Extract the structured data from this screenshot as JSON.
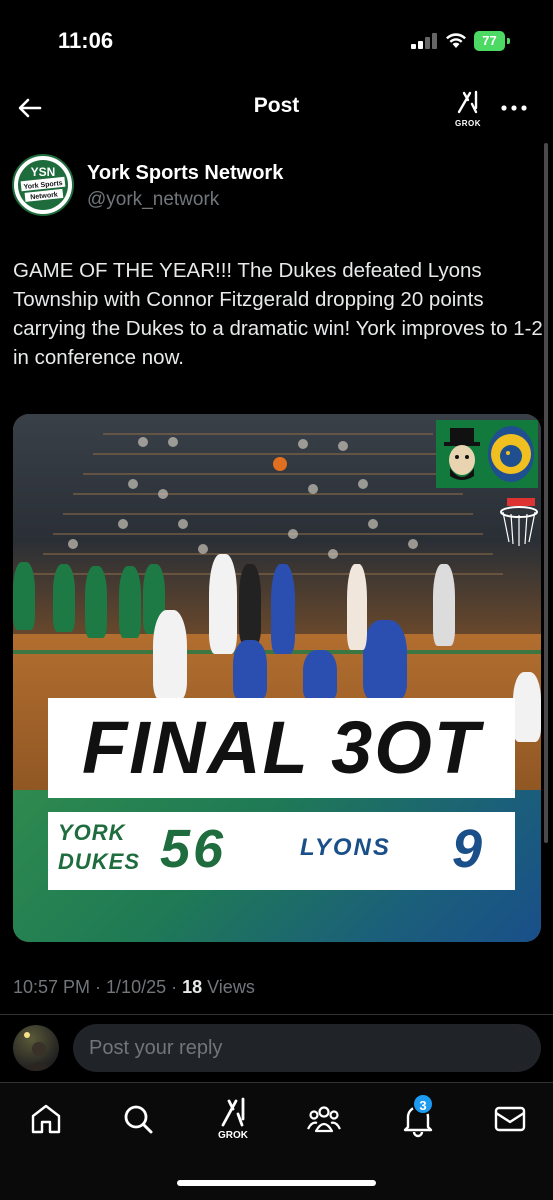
{
  "status_bar": {
    "time": "11:06",
    "battery": "77"
  },
  "header": {
    "title": "Post",
    "grok_label": "GROK"
  },
  "post": {
    "author_name": "York Sports Network",
    "author_handle": "@york_network",
    "avatar_text": {
      "top": "YSN",
      "middle": "York Sports",
      "bottom": "Network"
    },
    "text": "GAME OF THE YEAR!!! The Dukes defeated Lyons Township with Connor Fitzgerald dropping 20 points carrying the Dukes to a dramatic win! York improves to 1-2 in conference now.",
    "media": {
      "headline": "FINAL 3OT",
      "team_home_line1": "YORK",
      "team_home_line2": "DUKES",
      "score_home": "56",
      "team_away": "LYONS",
      "score_away": "9"
    },
    "timestamp": "10:57 PM · 1/10/25 · ",
    "views_count": "18",
    "views_label": " Views"
  },
  "reply": {
    "placeholder": "Post your reply"
  },
  "tab_bar": {
    "grok_label": "GROK",
    "notifications_badge": "3",
    "items": [
      "home-icon",
      "search-icon",
      "grok-icon",
      "communities-icon",
      "notifications-icon",
      "messages-icon"
    ]
  },
  "colors": {
    "background": "#000000",
    "accent": "#1d9bf0",
    "york_green": "#1f6d3e",
    "lyons_blue": "#1b4f8a"
  }
}
